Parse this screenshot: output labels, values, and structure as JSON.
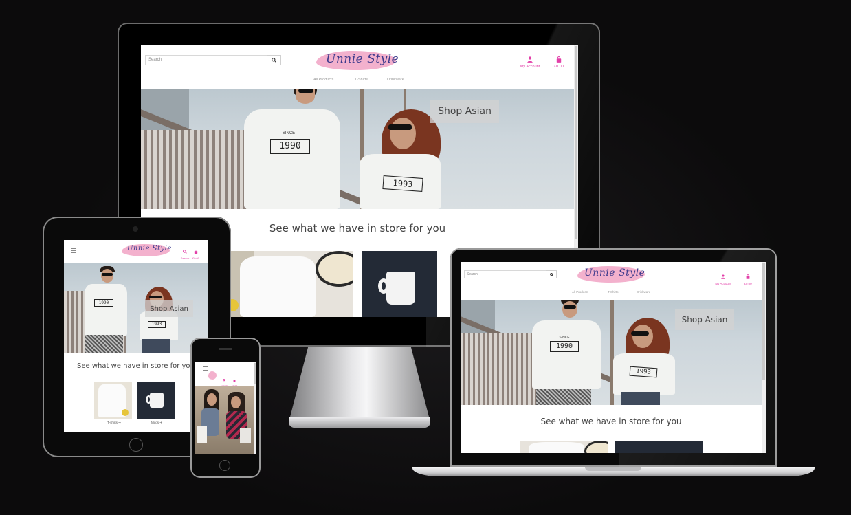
{
  "site": {
    "logo": "Unnie Style",
    "search_placeholder": "Search",
    "account_label": "My Account",
    "cart_total": "£0.00",
    "search_label": "Search",
    "nav": [
      "All Products",
      "T-Shirts",
      "Drinkware"
    ],
    "hero_button": "Shop Asian",
    "tagline": "See what we have in store for you",
    "shirt_years": [
      "1990",
      "1993"
    ],
    "shirt_since": "SINCE",
    "categories": [
      "T-shirts ➔",
      "Mugs ➔"
    ]
  },
  "colors": {
    "accent": "#e23ea8",
    "logo": "#3d3a8c",
    "logo_blob": "#f2a8c8",
    "background": "#0c0b0c"
  },
  "icons": [
    "search-icon",
    "user-icon",
    "shopping-bag-icon",
    "hamburger-menu-icon"
  ]
}
